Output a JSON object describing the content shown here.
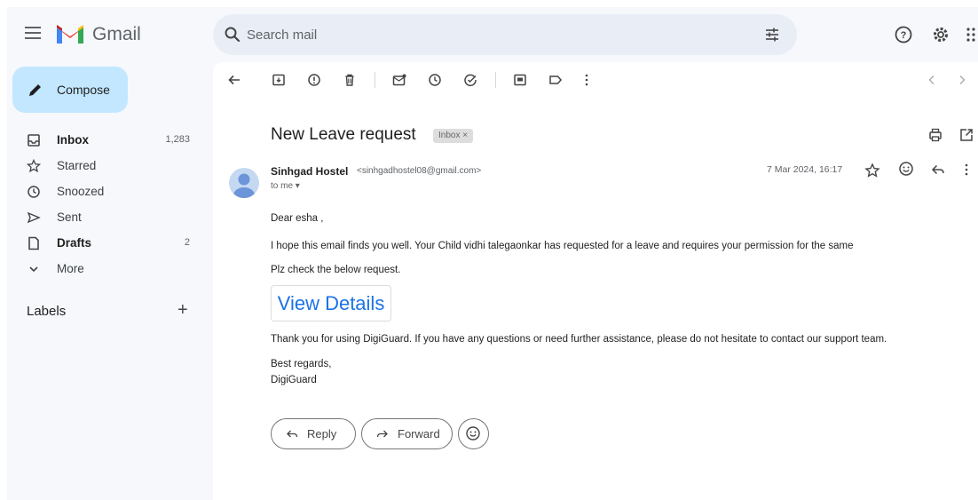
{
  "app": {
    "name": "Gmail"
  },
  "search": {
    "placeholder": "Search mail"
  },
  "compose": {
    "label": "Compose"
  },
  "sidebar": {
    "items": [
      {
        "label": "Inbox",
        "count": "1,283",
        "icon": "inbox-icon",
        "bold": true
      },
      {
        "label": "Starred",
        "count": "",
        "icon": "star-icon",
        "bold": false
      },
      {
        "label": "Snoozed",
        "count": "",
        "icon": "clock-icon",
        "bold": false
      },
      {
        "label": "Sent",
        "count": "",
        "icon": "send-icon",
        "bold": false
      },
      {
        "label": "Drafts",
        "count": "2",
        "icon": "draft-icon",
        "bold": true
      },
      {
        "label": "More",
        "count": "",
        "icon": "chevron-down-icon",
        "bold": false
      }
    ],
    "labels_title": "Labels"
  },
  "message": {
    "subject": "New Leave request",
    "label_chip": "Inbox ×",
    "sender_name": "Sinhgad Hostel",
    "sender_email": "<sinhgadhostel08@gmail.com>",
    "to": "to me ▾",
    "date": "7 Mar 2024, 16:17",
    "body": {
      "greeting": "Dear esha ,",
      "line1": "I hope this email finds you well. Your Child vidhi talegaonkar has requested for a leave and requires your permission for the same",
      "line2": "Plz check the below request.",
      "button": "View Details",
      "line3": "Thank you for using DigiGuard. If you have any questions or need further assistance, please do not hesitate to contact our support team.",
      "signoff": "Best regards,",
      "signature": "DigiGuard"
    }
  },
  "actions": {
    "reply": "Reply",
    "forward": "Forward"
  },
  "colors": {
    "accent": "#1a73e8",
    "compose_bg": "#c2e7ff",
    "app_bg": "#f6f8fc"
  }
}
